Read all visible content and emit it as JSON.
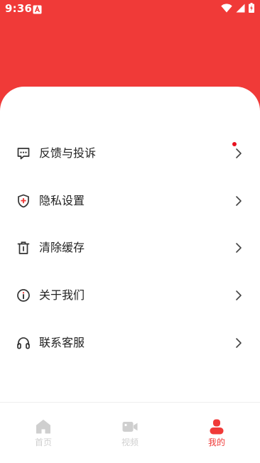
{
  "theme": {
    "brand_red": "#f03a38",
    "text_dark": "#222222",
    "tab_inactive": "#cfcfcf",
    "tab_active": "#f03a38",
    "notification_dot": "#e8121f"
  },
  "status_bar": {
    "time": "9:36",
    "icons": [
      "a-notification-icon",
      "wifi-icon",
      "signal-icon",
      "battery-charging-icon"
    ]
  },
  "menu": {
    "items": [
      {
        "label": "反馈与投诉",
        "icon": "feedback-message-icon",
        "has_notification_dot": true
      },
      {
        "label": "隐私设置",
        "icon": "privacy-shield-icon",
        "has_notification_dot": false
      },
      {
        "label": "清除缓存",
        "icon": "trash-icon",
        "has_notification_dot": false
      },
      {
        "label": "关于我们",
        "icon": "info-icon",
        "has_notification_dot": false
      },
      {
        "label": "联系客服",
        "icon": "headset-icon",
        "has_notification_dot": false
      }
    ]
  },
  "tabbar": {
    "tabs": [
      {
        "label": "首页",
        "icon": "home-icon",
        "active": false
      },
      {
        "label": "视频",
        "icon": "video-icon",
        "active": false
      },
      {
        "label": "我的",
        "icon": "profile-icon",
        "active": true
      }
    ]
  }
}
